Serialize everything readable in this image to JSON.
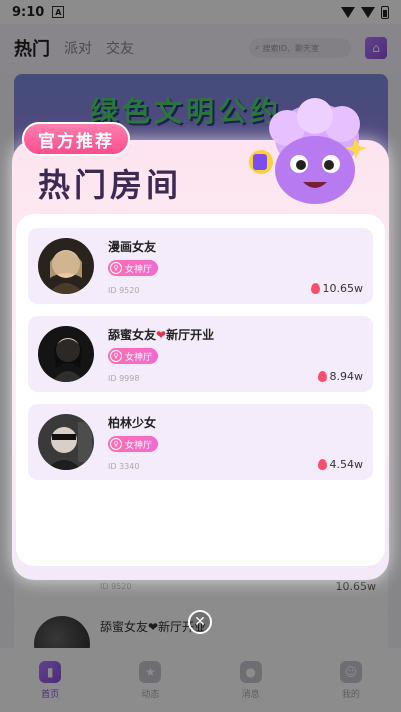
{
  "status": {
    "time": "9:10"
  },
  "topnav": {
    "tabs": [
      {
        "label": "热门"
      },
      {
        "label": "派对"
      },
      {
        "label": "交友"
      }
    ],
    "search_placeholder": "搜索ID、聊天室"
  },
  "banner": {
    "text": "绿色文明公约"
  },
  "background_list": [
    {
      "id_text": "ID 9520",
      "heat": "10.65w"
    },
    {
      "name": "舔蜜女友❤新厅开业"
    }
  ],
  "bottomnav": {
    "items": [
      {
        "label": "首页",
        "icon": "home-bars-icon",
        "active": true
      },
      {
        "label": "动态",
        "icon": "star-icon"
      },
      {
        "label": "消息",
        "icon": "chat-icon"
      },
      {
        "label": "我的",
        "icon": "profile-icon"
      }
    ]
  },
  "modal": {
    "badge": "官方推荐",
    "title": "热门房间",
    "rooms": [
      {
        "name": "漫画女友",
        "tag": "女神厅",
        "id_text": "ID 9520",
        "heat": "10.65w"
      },
      {
        "name_prefix": "舔蜜女友",
        "heart": "❤",
        "name_suffix": "新厅开业",
        "tag": "女神厅",
        "id_text": "ID 9998",
        "heat": "8.94w"
      },
      {
        "name": "柏林少女",
        "tag": "女神厅",
        "id_text": "ID 3340",
        "heat": "4.54w"
      }
    ],
    "close_symbol": "✕"
  },
  "colors": {
    "accent": "#8a4de8",
    "pink": "#ff4d8e",
    "heat": "#ff4d6d"
  }
}
